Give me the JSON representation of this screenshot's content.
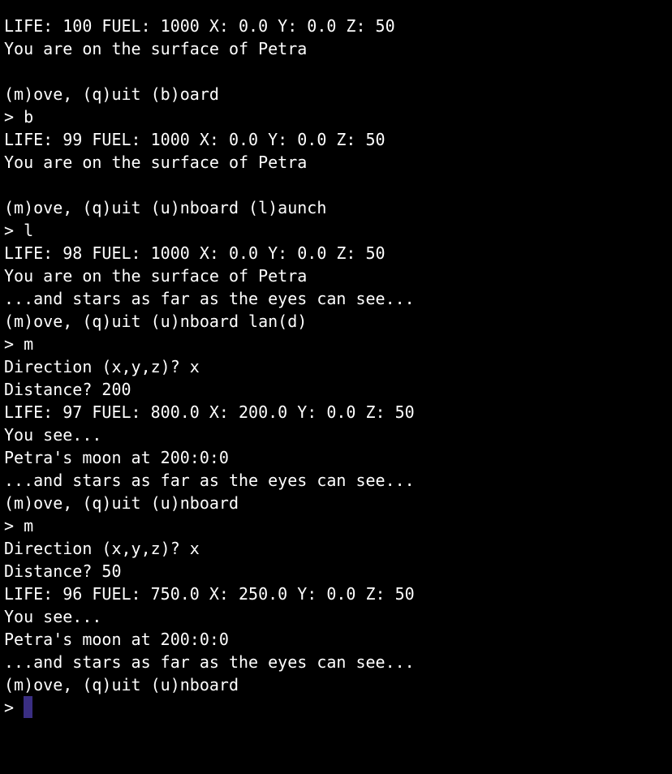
{
  "terminal": {
    "lines": [
      "LIFE: 100 FUEL: 1000 X: 0.0 Y: 0.0 Z: 50",
      "You are on the surface of Petra",
      "",
      "(m)ove, (q)uit (b)oard",
      "> b",
      "LIFE: 99 FUEL: 1000 X: 0.0 Y: 0.0 Z: 50",
      "You are on the surface of Petra",
      "",
      "(m)ove, (q)uit (u)nboard (l)aunch",
      "> l",
      "LIFE: 98 FUEL: 1000 X: 0.0 Y: 0.0 Z: 50",
      "You are on the surface of Petra",
      "...and stars as far as the eyes can see...",
      "(m)ove, (q)uit (u)nboard lan(d)",
      "> m",
      "Direction (x,y,z)? x",
      "Distance? 200",
      "LIFE: 97 FUEL: 800.0 X: 200.0 Y: 0.0 Z: 50",
      "You see...",
      "Petra's moon at 200:0:0",
      "...and stars as far as the eyes can see...",
      "(m)ove, (q)uit (u)nboard",
      "> m",
      "Direction (x,y,z)? x",
      "Distance? 50",
      "LIFE: 96 FUEL: 750.0 X: 250.0 Y: 0.0 Z: 50",
      "You see...",
      "Petra's moon at 200:0:0",
      "...and stars as far as the eyes can see...",
      "(m)ove, (q)uit (u)nboard"
    ],
    "prompt": "> ",
    "colors": {
      "background": "#000000",
      "foreground": "#ffffff",
      "cursor": "#3a2e82"
    }
  }
}
